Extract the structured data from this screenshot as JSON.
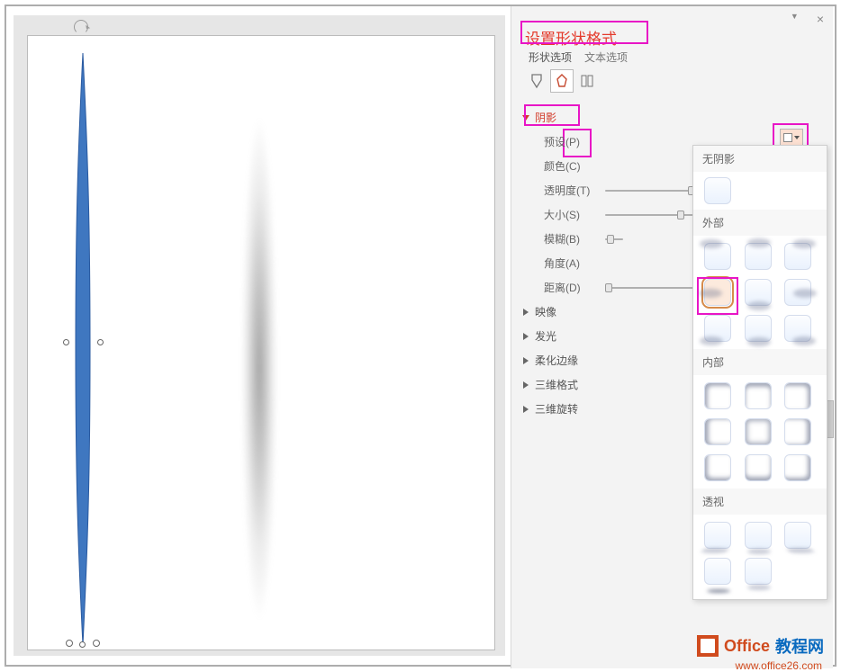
{
  "panel": {
    "title": "设置形状格式",
    "tabs": {
      "shape": "形状选项",
      "text": "文本选项"
    },
    "iconbar": {
      "fill": "fill-line-icon",
      "effects": "effects-icon",
      "size": "size-properties-icon"
    },
    "close": "×",
    "dropdown": "▼"
  },
  "sections": {
    "shadow": "阴影",
    "reflection": "映像",
    "glow": "发光",
    "softedge": "柔化边缘",
    "format3d": "三维格式",
    "rotate3d": "三维旋转"
  },
  "shadow_props": {
    "preset": "预设(P)",
    "color": "颜色(C)",
    "transparency": "透明度(T)",
    "size": "大小(S)",
    "blur": "模糊(B)",
    "angle": "角度(A)",
    "distance": "距离(D)"
  },
  "gallery": {
    "none_head": "无阴影",
    "outer_head": "外部",
    "inner_head": "内部",
    "persp_head": "透视"
  },
  "watermark": {
    "brand_first": "Office",
    "brand_cn": "教程网",
    "url": "www.office26.com"
  }
}
